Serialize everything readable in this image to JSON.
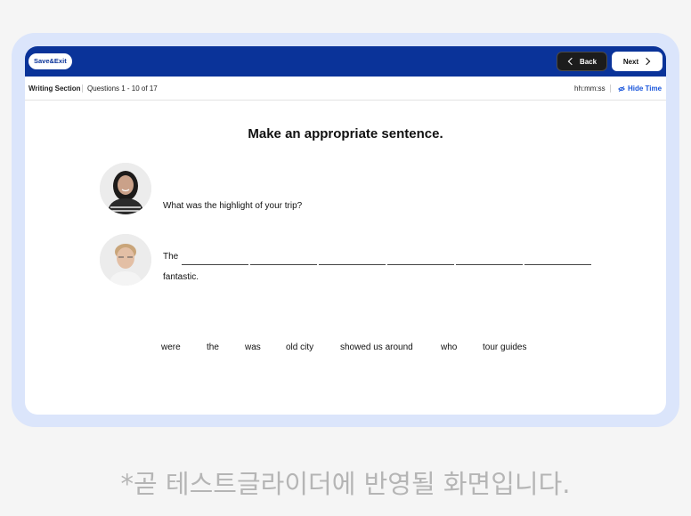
{
  "topbar": {
    "save_exit_label": "Save&Exit",
    "back_label": "Back",
    "next_label": "Next"
  },
  "subbar": {
    "section_label": "Writing Section",
    "questions_label": "Questions 1 - 10 of 17",
    "time_value": "hh:mm:ss",
    "hide_time_label": "Hide Time"
  },
  "main": {
    "instruction": "Make an appropriate sentence.",
    "question": "What was the highlight of your trip?",
    "answer_start": "The",
    "answer_end": "fantastic.",
    "blank_count": 6,
    "word_options": [
      "were",
      "the",
      "was",
      "old city",
      "showed us around",
      "who",
      "tour guides"
    ]
  },
  "caption": "*곧 테스트글라이더에 반영될 화면입니다.",
  "colors": {
    "topbar": "#0a3399",
    "frame": "#dbe5fb",
    "accent": "#1a56db"
  }
}
